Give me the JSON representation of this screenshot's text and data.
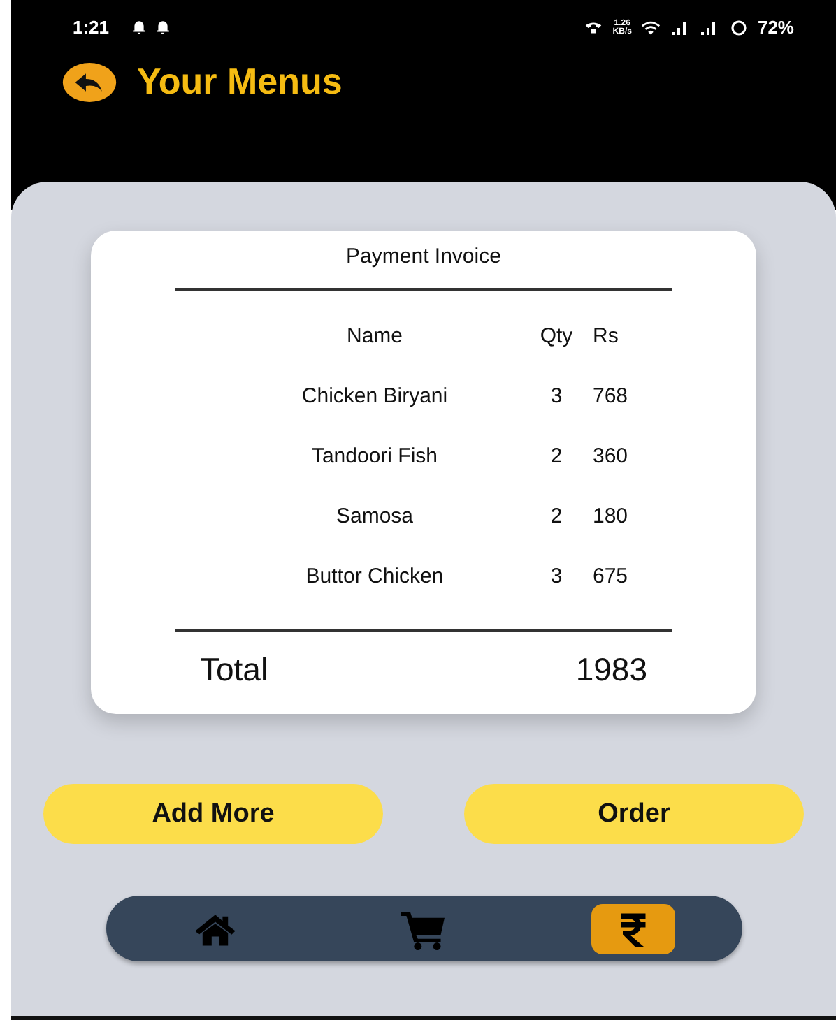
{
  "status_bar": {
    "time": "1:21",
    "speed": "1.26",
    "speed_unit": "KB/s",
    "battery": "72%"
  },
  "header": {
    "title": "Your Menus"
  },
  "invoice": {
    "title": "Payment Invoice",
    "columns": [
      "Name",
      "Qty",
      "Rs"
    ],
    "rows": [
      {
        "name": "Chicken Biryani",
        "qty": "3",
        "rs": "768"
      },
      {
        "name": "Tandoori Fish",
        "qty": "2",
        "rs": "360"
      },
      {
        "name": "Samosa",
        "qty": "2",
        "rs": "180"
      },
      {
        "name": "Buttor Chicken",
        "qty": "3",
        "rs": "675"
      }
    ],
    "total_label": "Total",
    "total": "1983"
  },
  "buttons": [
    "Add More",
    "Order"
  ],
  "nav": [
    {
      "kind": "home",
      "selected": false
    },
    {
      "kind": "cart",
      "selected": false
    },
    {
      "kind": "rupee",
      "selected": true
    }
  ]
}
